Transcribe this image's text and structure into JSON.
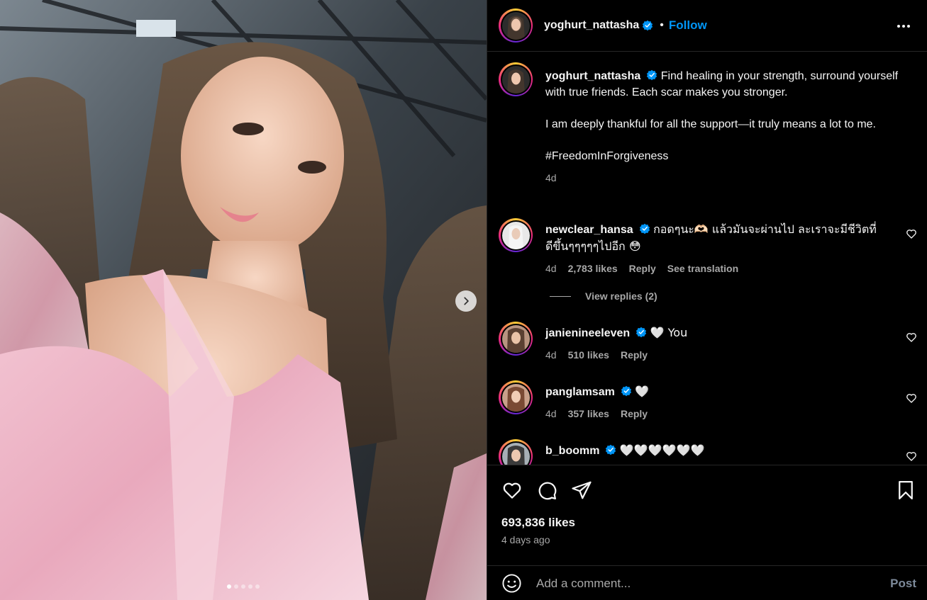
{
  "colors": {
    "background": "#000000",
    "text": "#f5f5f5",
    "muted": "#a8a8a8",
    "follow": "#0095f6",
    "verified": "#0095f6",
    "divider": "#262626"
  },
  "media": {
    "carousel_count": 5,
    "carousel_active_index": 0,
    "next_icon": "chevron-right-icon"
  },
  "header": {
    "username": "yoghurt_nattasha",
    "separator": "•",
    "follow_label": "Follow",
    "more_icon": "more-horizontal-icon"
  },
  "caption": {
    "username": "yoghurt_nattasha",
    "line1": "Find healing in your strength, surround yourself with true friends. Each scar makes you stronger.",
    "line2": "I am deeply thankful for all the support—it truly means a lot to me.",
    "hashtag": "#FreedomInForgiveness",
    "time": "4d"
  },
  "comments": [
    {
      "username": "newclear_hansa",
      "text": "กอดๆนะ🫶🏻 แล้วมันจะผ่านไป ละเราจะมีชีวิตที่ดีขึ้นๆๆๆๆๆไปอีก 😳",
      "time": "4d",
      "likes": "2,783 likes",
      "reply": "Reply",
      "translate": "See translation",
      "view_replies": "View replies (2)"
    },
    {
      "username": "janienineeleven",
      "text": "🤍 You",
      "time": "4d",
      "likes": "510 likes",
      "reply": "Reply"
    },
    {
      "username": "panglamsam",
      "text": "🤍",
      "time": "4d",
      "likes": "357 likes",
      "reply": "Reply"
    },
    {
      "username": "b_boomm",
      "text": "🤍🤍🤍🤍🤍🤍"
    }
  ],
  "actions": {
    "likes": "693,836 likes",
    "time_ago": "4 days ago",
    "comment_placeholder": "Add a comment...",
    "post_label": "Post"
  }
}
